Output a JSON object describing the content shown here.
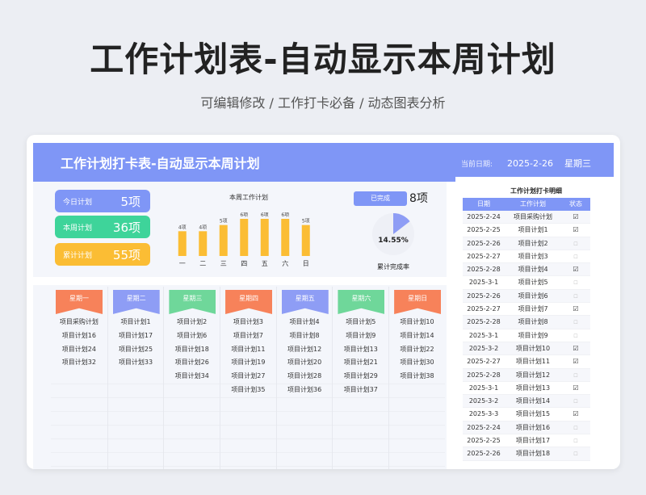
{
  "hero": {
    "title": "工作计划表-自动显示本周计划",
    "subtitle": "可编辑修改 /  工作打卡必备  /  动态图表分析"
  },
  "banner": {
    "title": "工作计划打卡表-自动显示本周计划",
    "date_label": "当前日期:",
    "date": "2025-2-26",
    "weekday": "星期三"
  },
  "stats": [
    {
      "label": "今日计划",
      "value": "5项",
      "color": "#7f96f6"
    },
    {
      "label": "本周计划",
      "value": "36项",
      "color": "#3ed49a"
    },
    {
      "label": "累计计划",
      "value": "55项",
      "color": "#fbbd34"
    }
  ],
  "chart_data": {
    "type": "bar",
    "title": "本周工作计划",
    "categories": [
      "一",
      "二",
      "三",
      "四",
      "五",
      "六",
      "日"
    ],
    "values": [
      4,
      4,
      5,
      6,
      6,
      6,
      5
    ],
    "data_labels": [
      "4项",
      "4项",
      "5项",
      "6项",
      "6项",
      "6项",
      "5项"
    ],
    "color": "#fbbd34",
    "ylim": [
      0,
      6
    ]
  },
  "completion": {
    "label": "已完成",
    "value": "8项",
    "percent": 14.55,
    "percent_text": "14.55%",
    "rate_label": "累计完成率",
    "color": "#8e9df5"
  },
  "week": [
    {
      "day": "星期一",
      "color": "#f7825a",
      "items": [
        "项目采购计划",
        "项目计划16",
        "项目计划24",
        "项目计划32"
      ]
    },
    {
      "day": "星期二",
      "color": "#8e9df5",
      "items": [
        "项目计划1",
        "项目计划17",
        "项目计划25",
        "项目计划33"
      ]
    },
    {
      "day": "星期三",
      "color": "#6fd79a",
      "items": [
        "项目计划2",
        "项目计划6",
        "项目计划18",
        "项目计划26",
        "项目计划34"
      ]
    },
    {
      "day": "星期四",
      "color": "#f7825a",
      "items": [
        "项目计划3",
        "项目计划7",
        "项目计划11",
        "项目计划19",
        "项目计划27",
        "项目计划35"
      ]
    },
    {
      "day": "星期五",
      "color": "#8e9df5",
      "items": [
        "项目计划4",
        "项目计划8",
        "项目计划12",
        "项目计划20",
        "项目计划28",
        "项目计划36"
      ]
    },
    {
      "day": "星期六",
      "color": "#6fd79a",
      "items": [
        "项目计划5",
        "项目计划9",
        "项目计划13",
        "项目计划21",
        "项目计划29",
        "项目计划37"
      ]
    },
    {
      "day": "星期日",
      "color": "#f7825a",
      "items": [
        "项目计划10",
        "项目计划14",
        "项目计划22",
        "项目计划30",
        "项目计划38"
      ]
    }
  ],
  "detail": {
    "title": "工作计划打卡明细",
    "headers": [
      "日期",
      "工作计划",
      "状态"
    ],
    "rows": [
      {
        "date": "2025-2-24",
        "plan": "项目采购计划",
        "done": true
      },
      {
        "date": "2025-2-25",
        "plan": "项目计划1",
        "done": true
      },
      {
        "date": "2025-2-26",
        "plan": "项目计划2",
        "done": false
      },
      {
        "date": "2025-2-27",
        "plan": "项目计划3",
        "done": false
      },
      {
        "date": "2025-2-28",
        "plan": "项目计划4",
        "done": true
      },
      {
        "date": "2025-3-1",
        "plan": "项目计划5",
        "done": false
      },
      {
        "date": "2025-2-26",
        "plan": "项目计划6",
        "done": false
      },
      {
        "date": "2025-2-27",
        "plan": "项目计划7",
        "done": true
      },
      {
        "date": "2025-2-28",
        "plan": "项目计划8",
        "done": false
      },
      {
        "date": "2025-3-1",
        "plan": "项目计划9",
        "done": false
      },
      {
        "date": "2025-3-2",
        "plan": "项目计划10",
        "done": true
      },
      {
        "date": "2025-2-27",
        "plan": "项目计划11",
        "done": true
      },
      {
        "date": "2025-2-28",
        "plan": "项目计划12",
        "done": false
      },
      {
        "date": "2025-3-1",
        "plan": "项目计划13",
        "done": true
      },
      {
        "date": "2025-3-2",
        "plan": "项目计划14",
        "done": false
      },
      {
        "date": "2025-3-3",
        "plan": "项目计划15",
        "done": true
      },
      {
        "date": "2025-2-24",
        "plan": "项目计划16",
        "done": false
      },
      {
        "date": "2025-2-25",
        "plan": "项目计划17",
        "done": false
      },
      {
        "date": "2025-2-26",
        "plan": "项目计划18",
        "done": false
      }
    ]
  }
}
